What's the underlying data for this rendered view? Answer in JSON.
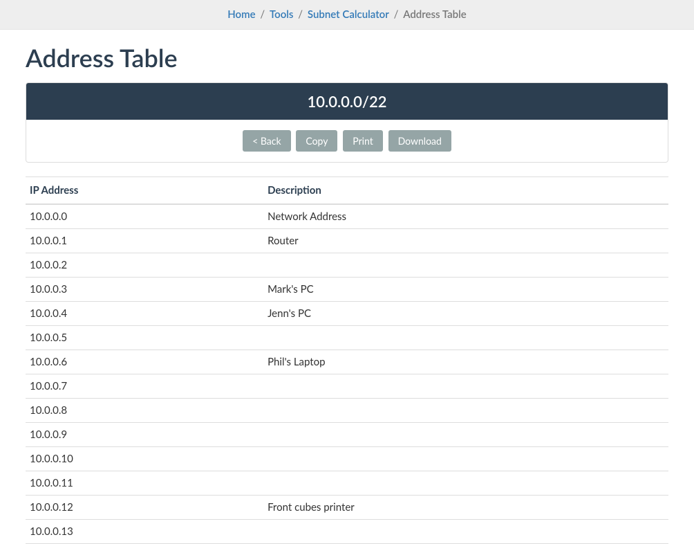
{
  "breadcrumb": {
    "home": "Home",
    "tools": "Tools",
    "subnet_calc": "Subnet Calculator",
    "current": "Address Table"
  },
  "page_title": "Address Table",
  "panel": {
    "heading": "10.0.0.0/22",
    "buttons": {
      "back": "< Back",
      "copy": "Copy",
      "print": "Print",
      "download": "Download"
    }
  },
  "table": {
    "headers": {
      "ip": "IP Address",
      "desc": "Description"
    },
    "rows": [
      {
        "ip": "10.0.0.0",
        "desc": "Network Address"
      },
      {
        "ip": "10.0.0.1",
        "desc": "Router"
      },
      {
        "ip": "10.0.0.2",
        "desc": ""
      },
      {
        "ip": "10.0.0.3",
        "desc": "Mark's PC"
      },
      {
        "ip": "10.0.0.4",
        "desc": "Jenn's PC"
      },
      {
        "ip": "10.0.0.5",
        "desc": ""
      },
      {
        "ip": "10.0.0.6",
        "desc": "Phil's Laptop"
      },
      {
        "ip": "10.0.0.7",
        "desc": ""
      },
      {
        "ip": "10.0.0.8",
        "desc": ""
      },
      {
        "ip": "10.0.0.9",
        "desc": ""
      },
      {
        "ip": "10.0.0.10",
        "desc": ""
      },
      {
        "ip": "10.0.0.11",
        "desc": ""
      },
      {
        "ip": "10.0.0.12",
        "desc": "Front cubes printer"
      },
      {
        "ip": "10.0.0.13",
        "desc": ""
      }
    ]
  }
}
